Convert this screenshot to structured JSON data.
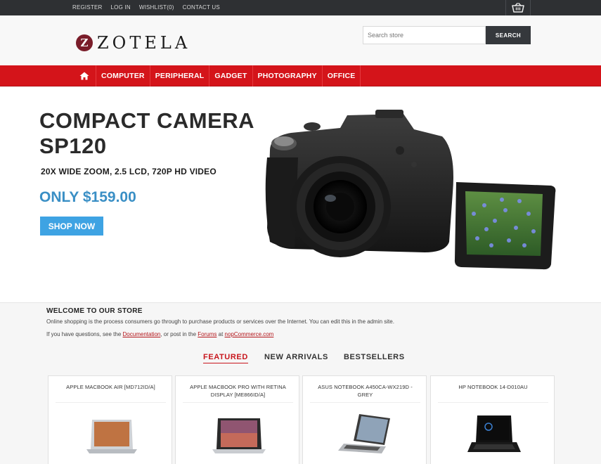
{
  "topbar": {
    "links": [
      "REGISTER",
      "LOG IN",
      "WISHLIST(0)",
      "CONTACT US"
    ],
    "cart_icon": "basket-icon"
  },
  "header": {
    "logo_letter": "Z",
    "logo_text": "ZOTELA",
    "search_placeholder": "Search store",
    "search_button": "SEARCH"
  },
  "nav": {
    "home_icon": "home-icon",
    "items": [
      "COMPUTER",
      "PERIPHERAL",
      "GADGET",
      "PHOTOGRAPHY",
      "OFFICE"
    ]
  },
  "hero": {
    "title": "COMPACT CAMERA SP120",
    "subtitle": "20X WIDE ZOOM, 2.5 LCD, 720P HD VIDEO",
    "price": "ONLY $159.00",
    "button": "SHOP NOW"
  },
  "welcome": {
    "title": "WELCOME TO OUR STORE",
    "text": "Online shopping is the process consumers go through to purchase products or services over the Internet. You can edit this in the admin site.",
    "links_prefix": "If you have questions, see the",
    "doc_link": "Documentation",
    "links_middle": ", or post in the",
    "forums_link": "Forums",
    "links_at": "at",
    "site_link": "nopCommerce.com"
  },
  "tabs": [
    "FEATURED",
    "NEW ARRIVALS",
    "BESTSELLERS"
  ],
  "products": [
    {
      "name": "APPLE MACBOOK AIR [MD712ID/A]"
    },
    {
      "name": "APPLE MACBOOK PRO WITH RETINA DISPLAY [ME866ID/A]"
    },
    {
      "name": "ASUS NOTEBOOK A450CA-WX219D - GREY"
    },
    {
      "name": "HP NOTEBOOK 14-D010AU"
    }
  ],
  "colors": {
    "nav_red": "#d4141a",
    "topbar": "#2e3033",
    "accent_blue": "#3ea3e3",
    "price_blue": "#3a8fc5"
  }
}
